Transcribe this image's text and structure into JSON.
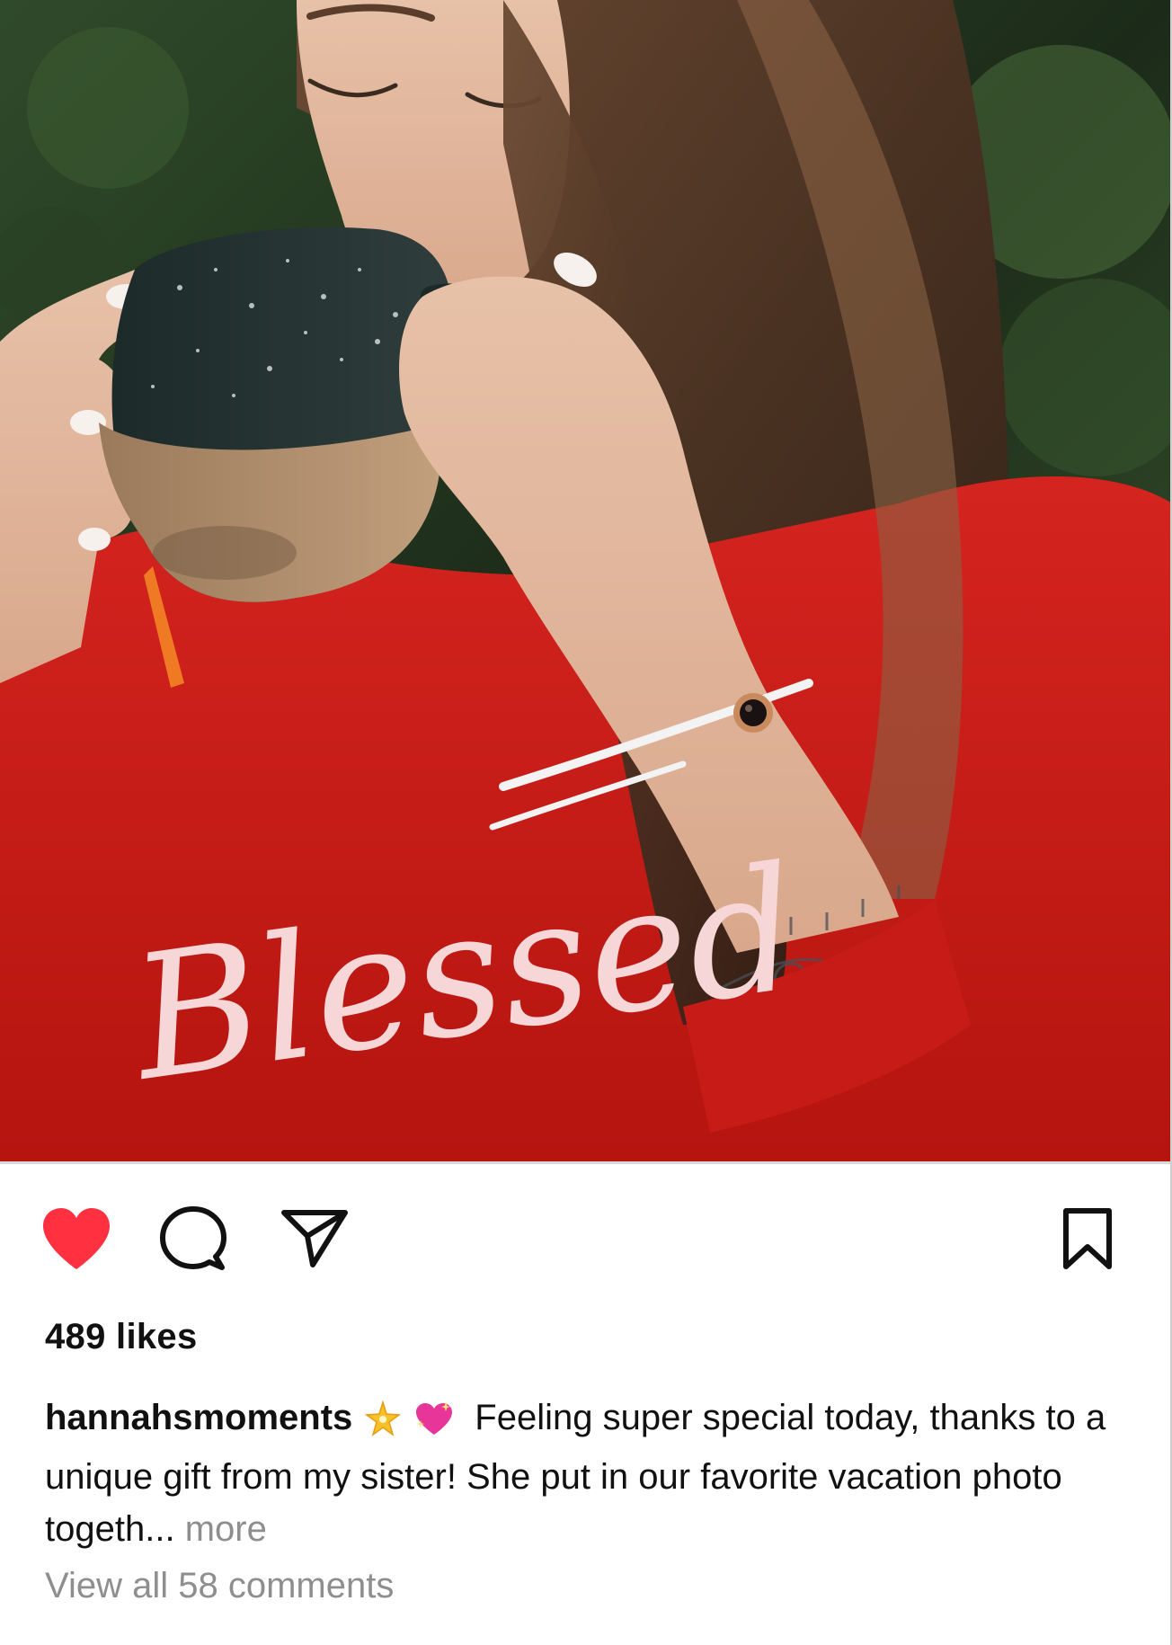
{
  "post": {
    "photo_alt": "Woman in red Blessed sweater sipping from a speckled mug, wearing a white rope bracelet with a black stone charm",
    "photo_text": "Blessed"
  },
  "actions": {
    "like_icon": "heart-filled-icon",
    "comment_icon": "speech-bubble-icon",
    "share_icon": "paper-plane-icon",
    "save_icon": "bookmark-icon",
    "like_color": "#ff3040"
  },
  "likes": {
    "text": "489 likes"
  },
  "caption": {
    "username": "hannahsmoments",
    "emoji_1": "sparkles-star-icon",
    "emoji_2": "sparkling-heart-icon",
    "text": "Feeling super special today, thanks to a unique gift from my sister! She put in our favorite vacation photo togeth...",
    "more": "more"
  },
  "comments": {
    "view_all": "View all 58 comments"
  }
}
